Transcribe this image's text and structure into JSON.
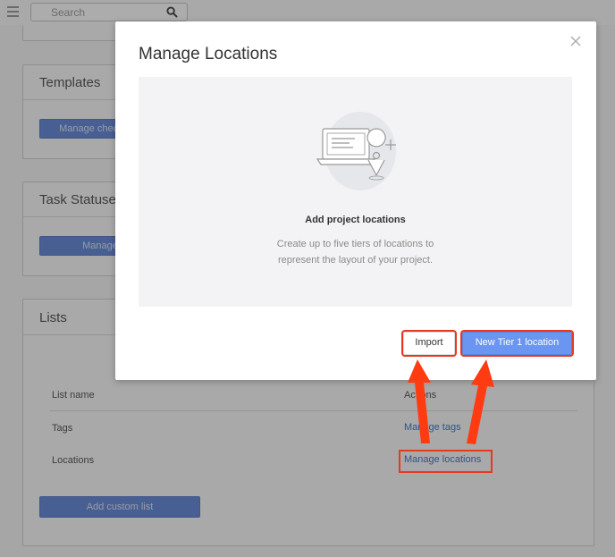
{
  "topbar": {
    "search_placeholder": "Search",
    "menu_icon": "hamburger-icon",
    "search_icon": "search-icon"
  },
  "background": {
    "templates": {
      "title": "Templates",
      "button_label": "Manage checklist templates"
    },
    "task_statuses": {
      "title": "Task Statuses",
      "button_label": "Manage statuses"
    },
    "lists": {
      "title": "Lists",
      "columns": [
        "List name",
        "Actions"
      ],
      "rows": [
        {
          "name": "Tags",
          "action": "Manage tags"
        },
        {
          "name": "Locations",
          "action": "Manage locations"
        }
      ],
      "add_button_label": "Add custom list"
    }
  },
  "modal": {
    "title": "Manage Locations",
    "empty_state": {
      "title": "Add project locations",
      "description_lines": [
        "Create up to five tiers of locations to",
        "represent the layout of your project."
      ]
    },
    "import_label": "Import",
    "new_tier_label": "New Tier 1 location"
  },
  "colors": {
    "accent": "#6a95f0",
    "link": "#1f58c6",
    "highlight": "#e8381f",
    "arrow": "#ff3b12"
  }
}
